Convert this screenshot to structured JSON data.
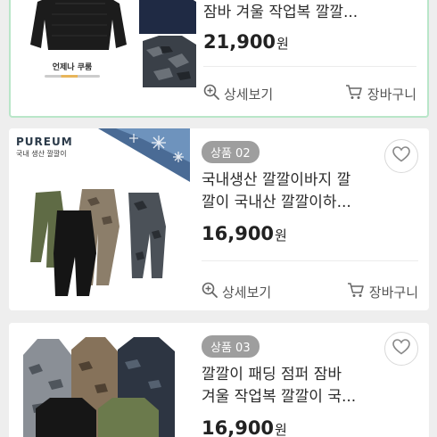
{
  "products": [
    {
      "title_visible": "잠바 겨울 작업복 깔깔...",
      "price": "21,900",
      "currency": "원",
      "thumb_caption": "언제나 쿠룸",
      "detail_label": "상세보기",
      "cart_label": "장바구니"
    },
    {
      "badge": "상품 02",
      "title_line1": "국내생산 깔깔이바지 깔",
      "title_line2": "깔이 국내산 깔깔이하...",
      "price": "16,900",
      "currency": "원",
      "brand": "PUREUM",
      "brand_sub": "국내 생산 깔깔이",
      "detail_label": "상세보기",
      "cart_label": "장바구니"
    },
    {
      "badge": "상품 03",
      "title_line1": "깔깔이 패딩 점퍼 잠바",
      "title_line2": "겨울 작업복 깔깔이 국...",
      "price": "16,900",
      "currency": "원"
    }
  ],
  "colors": {
    "accent_border": "#b9e6c9",
    "badge": "#9e9e9e",
    "card": "#ffffff",
    "background": "#eeeeee"
  },
  "icons": [
    "magnifier-plus-icon",
    "cart-icon",
    "heart-icon"
  ]
}
